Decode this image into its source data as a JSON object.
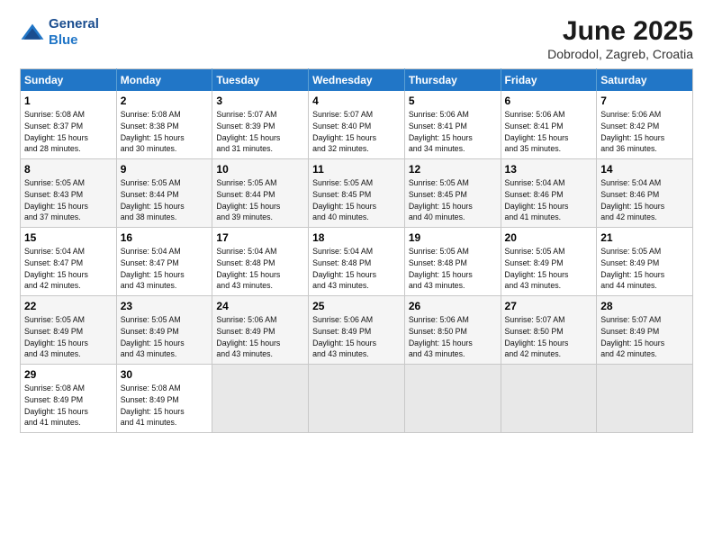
{
  "logo": {
    "general": "General",
    "blue": "Blue"
  },
  "title": "June 2025",
  "subtitle": "Dobrodol, Zagreb, Croatia",
  "header_days": [
    "Sunday",
    "Monday",
    "Tuesday",
    "Wednesday",
    "Thursday",
    "Friday",
    "Saturday"
  ],
  "weeks": [
    [
      {
        "day": "1",
        "info": "Sunrise: 5:08 AM\nSunset: 8:37 PM\nDaylight: 15 hours\nand 28 minutes."
      },
      {
        "day": "2",
        "info": "Sunrise: 5:08 AM\nSunset: 8:38 PM\nDaylight: 15 hours\nand 30 minutes."
      },
      {
        "day": "3",
        "info": "Sunrise: 5:07 AM\nSunset: 8:39 PM\nDaylight: 15 hours\nand 31 minutes."
      },
      {
        "day": "4",
        "info": "Sunrise: 5:07 AM\nSunset: 8:40 PM\nDaylight: 15 hours\nand 32 minutes."
      },
      {
        "day": "5",
        "info": "Sunrise: 5:06 AM\nSunset: 8:41 PM\nDaylight: 15 hours\nand 34 minutes."
      },
      {
        "day": "6",
        "info": "Sunrise: 5:06 AM\nSunset: 8:41 PM\nDaylight: 15 hours\nand 35 minutes."
      },
      {
        "day": "7",
        "info": "Sunrise: 5:06 AM\nSunset: 8:42 PM\nDaylight: 15 hours\nand 36 minutes."
      }
    ],
    [
      {
        "day": "8",
        "info": "Sunrise: 5:05 AM\nSunset: 8:43 PM\nDaylight: 15 hours\nand 37 minutes."
      },
      {
        "day": "9",
        "info": "Sunrise: 5:05 AM\nSunset: 8:44 PM\nDaylight: 15 hours\nand 38 minutes."
      },
      {
        "day": "10",
        "info": "Sunrise: 5:05 AM\nSunset: 8:44 PM\nDaylight: 15 hours\nand 39 minutes."
      },
      {
        "day": "11",
        "info": "Sunrise: 5:05 AM\nSunset: 8:45 PM\nDaylight: 15 hours\nand 40 minutes."
      },
      {
        "day": "12",
        "info": "Sunrise: 5:05 AM\nSunset: 8:45 PM\nDaylight: 15 hours\nand 40 minutes."
      },
      {
        "day": "13",
        "info": "Sunrise: 5:04 AM\nSunset: 8:46 PM\nDaylight: 15 hours\nand 41 minutes."
      },
      {
        "day": "14",
        "info": "Sunrise: 5:04 AM\nSunset: 8:46 PM\nDaylight: 15 hours\nand 42 minutes."
      }
    ],
    [
      {
        "day": "15",
        "info": "Sunrise: 5:04 AM\nSunset: 8:47 PM\nDaylight: 15 hours\nand 42 minutes."
      },
      {
        "day": "16",
        "info": "Sunrise: 5:04 AM\nSunset: 8:47 PM\nDaylight: 15 hours\nand 43 minutes."
      },
      {
        "day": "17",
        "info": "Sunrise: 5:04 AM\nSunset: 8:48 PM\nDaylight: 15 hours\nand 43 minutes."
      },
      {
        "day": "18",
        "info": "Sunrise: 5:04 AM\nSunset: 8:48 PM\nDaylight: 15 hours\nand 43 minutes."
      },
      {
        "day": "19",
        "info": "Sunrise: 5:05 AM\nSunset: 8:48 PM\nDaylight: 15 hours\nand 43 minutes."
      },
      {
        "day": "20",
        "info": "Sunrise: 5:05 AM\nSunset: 8:49 PM\nDaylight: 15 hours\nand 43 minutes."
      },
      {
        "day": "21",
        "info": "Sunrise: 5:05 AM\nSunset: 8:49 PM\nDaylight: 15 hours\nand 44 minutes."
      }
    ],
    [
      {
        "day": "22",
        "info": "Sunrise: 5:05 AM\nSunset: 8:49 PM\nDaylight: 15 hours\nand 43 minutes."
      },
      {
        "day": "23",
        "info": "Sunrise: 5:05 AM\nSunset: 8:49 PM\nDaylight: 15 hours\nand 43 minutes."
      },
      {
        "day": "24",
        "info": "Sunrise: 5:06 AM\nSunset: 8:49 PM\nDaylight: 15 hours\nand 43 minutes."
      },
      {
        "day": "25",
        "info": "Sunrise: 5:06 AM\nSunset: 8:49 PM\nDaylight: 15 hours\nand 43 minutes."
      },
      {
        "day": "26",
        "info": "Sunrise: 5:06 AM\nSunset: 8:50 PM\nDaylight: 15 hours\nand 43 minutes."
      },
      {
        "day": "27",
        "info": "Sunrise: 5:07 AM\nSunset: 8:50 PM\nDaylight: 15 hours\nand 42 minutes."
      },
      {
        "day": "28",
        "info": "Sunrise: 5:07 AM\nSunset: 8:49 PM\nDaylight: 15 hours\nand 42 minutes."
      }
    ],
    [
      {
        "day": "29",
        "info": "Sunrise: 5:08 AM\nSunset: 8:49 PM\nDaylight: 15 hours\nand 41 minutes."
      },
      {
        "day": "30",
        "info": "Sunrise: 5:08 AM\nSunset: 8:49 PM\nDaylight: 15 hours\nand 41 minutes."
      },
      {
        "day": "",
        "info": ""
      },
      {
        "day": "",
        "info": ""
      },
      {
        "day": "",
        "info": ""
      },
      {
        "day": "",
        "info": ""
      },
      {
        "day": "",
        "info": ""
      }
    ]
  ]
}
